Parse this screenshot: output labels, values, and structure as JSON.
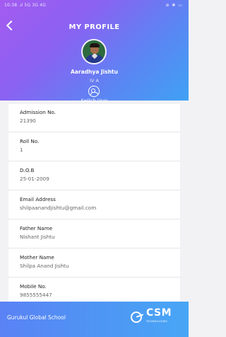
{
  "status_bar": {
    "left": "10:38 .ıl 5G 3G 4G",
    "right": "⊕ ✱ ▭"
  },
  "header": {
    "title": "MY PROFILE",
    "student_name": "Aaradhya Jishtu",
    "class_section": "IV A",
    "switch_user_label": "Switch User"
  },
  "profile_fields": [
    {
      "label": "Admission No.",
      "value": "21390"
    },
    {
      "label": "Roll No.",
      "value": "1"
    },
    {
      "label": "D.O.B",
      "value": "25-01-2009"
    },
    {
      "label": "Email Address",
      "value": "shilpaanandjishtu@gmail.com"
    },
    {
      "label": "Father Name",
      "value": "Nishant Jishtu"
    },
    {
      "label": "Mother Name",
      "value": "Shilpa Anand  Jishtu"
    },
    {
      "label": "Mobile No.",
      "value": "9855555447"
    }
  ],
  "footer": {
    "school_name": "Gurukul Global School",
    "logo_text": "CSM",
    "logo_subtext": "TECHNOLOGIES"
  },
  "colors": {
    "header_gradient_start": "#a45bf0",
    "header_gradient_end": "#3fa2f4",
    "footer_color": "#4d98f4",
    "card_background": "#ffffff",
    "page_background": "#f2f2f4"
  },
  "icons": {
    "back": "chevron-left-icon",
    "avatar": "student-avatar",
    "switch_user": "switch-user-icon",
    "logo": "csm-logo"
  }
}
